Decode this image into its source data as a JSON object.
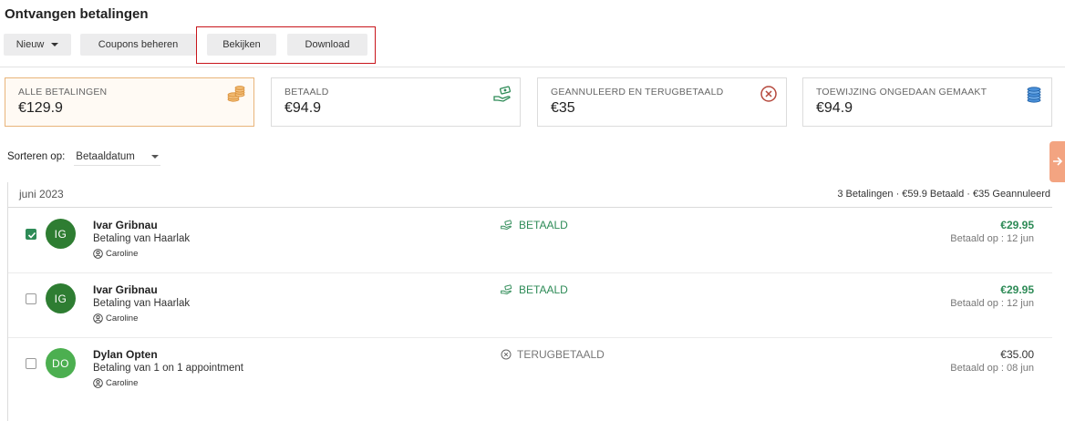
{
  "page": {
    "title": "Ontvangen betalingen"
  },
  "toolbar": {
    "nieuw_label": "Nieuw",
    "coupons_label": "Coupons beheren",
    "bekijken_label": "Bekijken",
    "download_label": "Download"
  },
  "summary_cards": [
    {
      "label": "ALLE BETALINGEN",
      "value": "€129.9",
      "icon": "coins-stack-icon",
      "active": true
    },
    {
      "label": "BETAALD",
      "value": "€94.9",
      "icon": "money-hand-icon",
      "active": false
    },
    {
      "label": "GEANNULEERD EN TERUGBETAALD",
      "value": "€35",
      "icon": "cancel-circle-icon",
      "active": false
    },
    {
      "label": "TOEWIJZING ONGEDAAN GEMAAKT",
      "value": "€94.9",
      "icon": "coins-blue-icon",
      "active": false
    }
  ],
  "sort": {
    "label": "Sorteren op:",
    "selected": "Betaaldatum"
  },
  "month_group": {
    "label": "juni 2023",
    "summary": "3 Betalingen  · €59.9 Betaald  · €35 Geannuleerd"
  },
  "payments": [
    {
      "initials": "IG",
      "name": "Ivar Gribnau",
      "description": "Betaling van Haarlak",
      "user": "Caroline",
      "status": "BETAALD",
      "amount": "€29.95",
      "date": "Betaald op : 12 jun",
      "checked": true,
      "avatar_color": "#2e7d32"
    },
    {
      "initials": "IG",
      "name": "Ivar Gribnau",
      "description": "Betaling van Haarlak",
      "user": "Caroline",
      "status": "BETAALD",
      "amount": "€29.95",
      "date": "Betaald op : 12 jun",
      "checked": false,
      "avatar_color": "#2e7d32"
    },
    {
      "initials": "DO",
      "name": "Dylan Opten",
      "description": "Betaling van 1 on 1 appointment",
      "user": "Caroline",
      "status": "TERUGBETAALD",
      "amount": "€35.00",
      "date": "Betaald op : 08 jun",
      "checked": false,
      "avatar_color": "#4caf50"
    }
  ],
  "colors": {
    "paid_green": "#2e8b57",
    "refund_gray": "#777777",
    "highlight_red": "#c8151b",
    "active_card_border": "#e9b47a",
    "side_tab": "#f3a481"
  }
}
